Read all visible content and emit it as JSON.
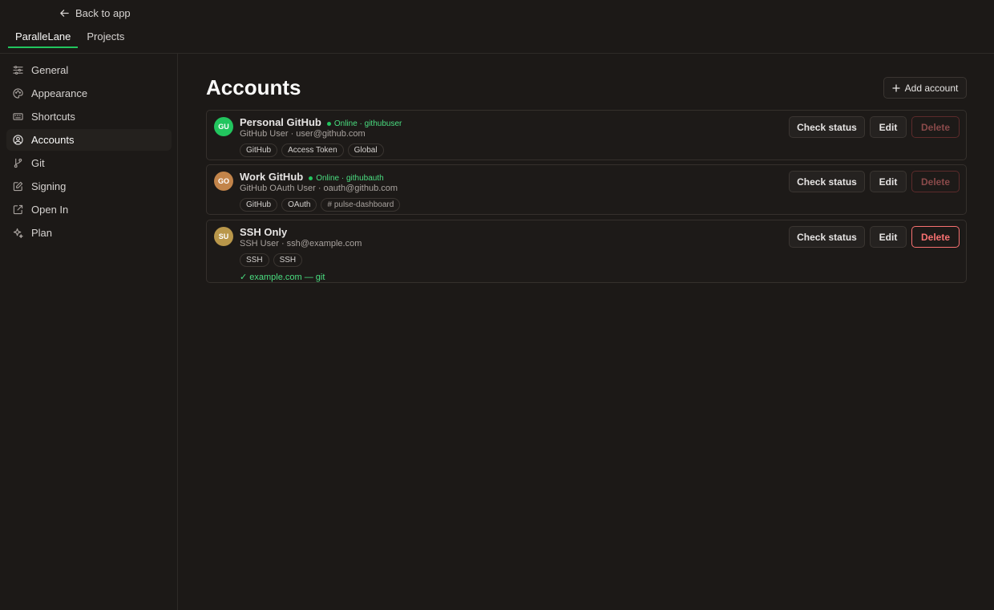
{
  "topbar": {
    "back_label": "Back to app",
    "tabs": [
      {
        "label": "ParalleLane",
        "active": true
      },
      {
        "label": "Projects",
        "active": false
      }
    ]
  },
  "sidebar": {
    "items": [
      {
        "label": "General",
        "icon": "sliders-icon"
      },
      {
        "label": "Appearance",
        "icon": "palette-icon"
      },
      {
        "label": "Shortcuts",
        "icon": "keyboard-icon"
      },
      {
        "label": "Accounts",
        "icon": "user-circle-icon",
        "active": true
      },
      {
        "label": "Git",
        "icon": "git-branch-icon"
      },
      {
        "label": "Signing",
        "icon": "pen-square-icon"
      },
      {
        "label": "Open In",
        "icon": "external-link-icon"
      },
      {
        "label": "Plan",
        "icon": "sparkles-icon"
      }
    ]
  },
  "main": {
    "title": "Accounts",
    "add_button_label": "Add account",
    "accounts": [
      {
        "initials": "GU",
        "avatar_color": "#22c55e",
        "name": "Personal GitHub",
        "status": "Online · githubuser",
        "subtitle": "GitHub User · user@github.com",
        "chips": [
          "GitHub",
          "Access Token",
          "Global"
        ],
        "check_label": "Check status",
        "edit_label": "Edit",
        "delete_label": "Delete"
      },
      {
        "initials": "GO",
        "avatar_color": "#c2844a",
        "name": "Work GitHub",
        "status": "Online · githubauth",
        "subtitle": "GitHub OAuth User · oauth@github.com",
        "chips": [
          "GitHub",
          "OAuth",
          "# pulse-dashboard"
        ],
        "check_label": "Check status",
        "edit_label": "Edit",
        "delete_label": "Delete"
      },
      {
        "initials": "SU",
        "avatar_color": "#b9974a",
        "name": "SSH Only",
        "subtitle": "SSH User · ssh@example.com",
        "chips": [
          "SSH",
          "SSH"
        ],
        "note": "✓ example.com — git",
        "check_label": "Check status",
        "edit_label": "Edit",
        "delete_label": "Delete"
      }
    ]
  },
  "colors": {
    "accent": "#22c55e",
    "online": "#4ade80",
    "danger": "#f87171",
    "background": "#1c1917"
  }
}
